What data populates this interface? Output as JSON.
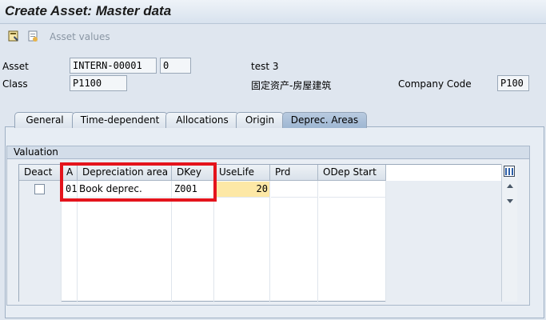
{
  "window": {
    "title": "Create Asset:  Master data"
  },
  "toolbar": {
    "asset_values_label": "Asset values"
  },
  "header": {
    "asset_label": "Asset",
    "asset_number": "INTERN-00001",
    "asset_subnumber": "0",
    "asset_description": "test 3",
    "class_label": "Class",
    "class_value": "P1100",
    "class_description": "固定资产-房屋建筑",
    "company_code_label": "Company Code",
    "company_code_value": "P100"
  },
  "tabs": [
    {
      "label": "General"
    },
    {
      "label": "Time-dependent"
    },
    {
      "label": "Allocations"
    },
    {
      "label": "Origin"
    },
    {
      "label": "Deprec. Areas",
      "active": true
    }
  ],
  "valuation": {
    "group_title": "Valuation",
    "columns": [
      "Deact",
      "A",
      "Depreciation area",
      "DKey",
      "UseLife",
      "Prd",
      "ODep Start"
    ],
    "rows": [
      {
        "deact": false,
        "area": "01",
        "depreciation_area": "Book deprec.",
        "dkey": "Z001",
        "uselife": "20",
        "prd": "",
        "odep_start": ""
      }
    ]
  },
  "colors": {
    "highlight": "#e4141c",
    "input_required": "#fde8a6",
    "active_tab": "#a9bfd9"
  }
}
